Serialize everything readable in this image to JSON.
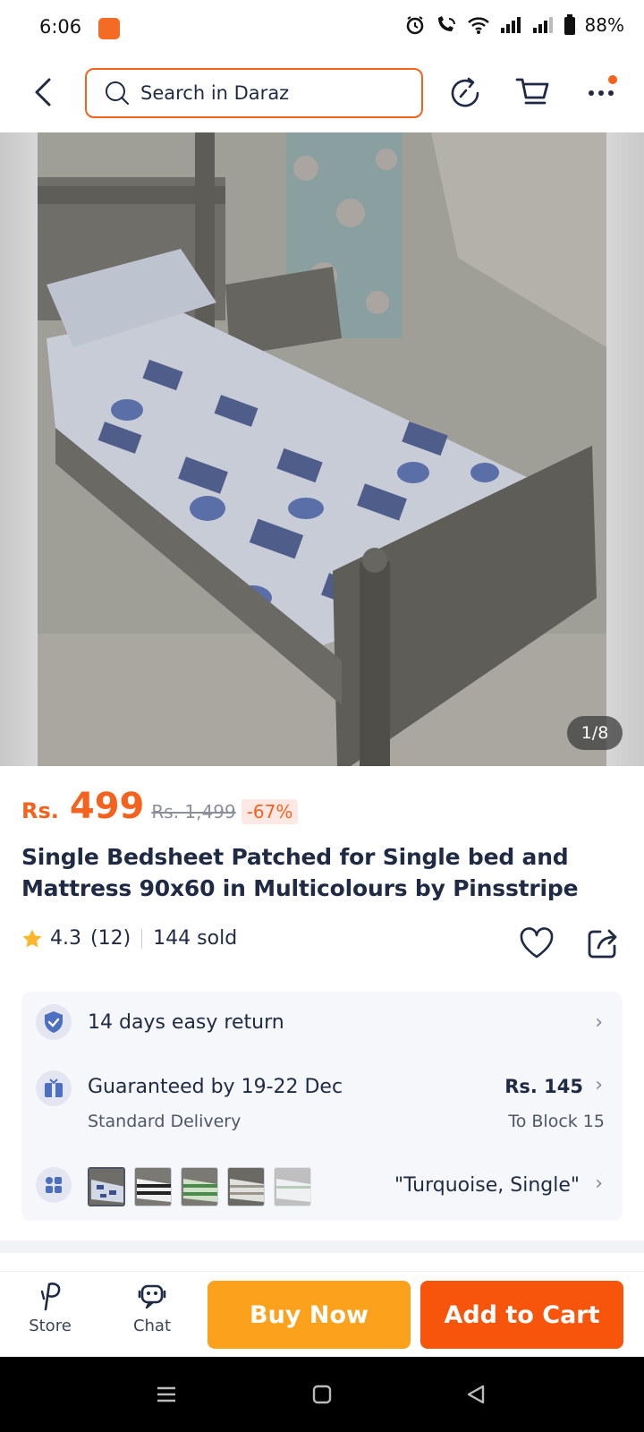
{
  "status_bar": {
    "time": "6:06",
    "battery": "88%"
  },
  "search": {
    "placeholder": "Search in Daraz"
  },
  "gallery": {
    "page_indicator": "1/8"
  },
  "product": {
    "currency": "Rs.",
    "price": "499",
    "original_price": "Rs. 1,499",
    "discount": "-67%",
    "title": "Single Bedsheet Patched for Single bed and Mattress 90x60 in Multicolours by Pinsstripe",
    "rating": "4.3",
    "review_count": "(12)",
    "sold": "144 sold"
  },
  "info": {
    "return_policy": "14 days easy return",
    "delivery_guarantee": "Guaranteed by 19-22 Dec",
    "delivery_type": "Standard Delivery",
    "delivery_fee": "Rs. 145",
    "delivery_location": "To Block 15",
    "variant": "\"Turquoise, Single\""
  },
  "colors": {
    "accent": "#f5621e",
    "buy_now": "#fca11c",
    "add_to_cart": "#f8550c",
    "star": "#fbb72c"
  },
  "bottom_bar": {
    "store_label": "Store",
    "chat_label": "Chat",
    "buy_now_label": "Buy Now",
    "add_to_cart_label": "Add to Cart"
  }
}
